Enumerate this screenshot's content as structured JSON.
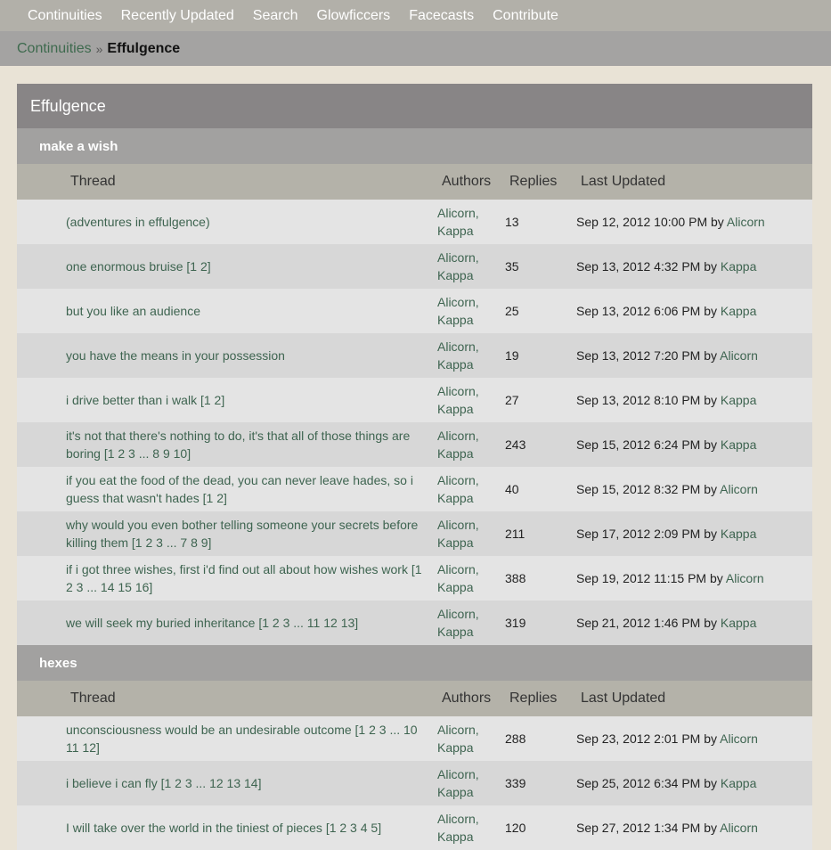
{
  "nav": {
    "items": [
      "Continuities",
      "Recently Updated",
      "Search",
      "Glowficcers",
      "Facecasts",
      "Contribute"
    ]
  },
  "breadcrumb": {
    "parent": "Continuities",
    "separator": "»",
    "current": "Effulgence"
  },
  "continuity": {
    "title": "Effulgence",
    "headers": {
      "thread": "Thread",
      "authors": "Authors",
      "replies": "Replies",
      "updated": "Last Updated"
    },
    "sections": [
      {
        "title": "make a wish",
        "threads": [
          {
            "title": "(adventures in effulgence)",
            "pages": "",
            "author1": "Alicorn,",
            "author2": "Kappa",
            "replies": "13",
            "date": "Sep 12, 2012 10:00 PM",
            "by": "by",
            "last_author": "Alicorn"
          },
          {
            "title": "one enormous bruise",
            "pages": "[1 2]",
            "author1": "Alicorn,",
            "author2": "Kappa",
            "replies": "35",
            "date": "Sep 13, 2012 4:32 PM",
            "by": "by",
            "last_author": "Kappa"
          },
          {
            "title": "but you like an audience",
            "pages": "",
            "author1": "Alicorn,",
            "author2": "Kappa",
            "replies": "25",
            "date": "Sep 13, 2012 6:06 PM",
            "by": "by",
            "last_author": "Kappa"
          },
          {
            "title": "you have the means in your possession",
            "pages": "",
            "author1": "Alicorn,",
            "author2": "Kappa",
            "replies": "19",
            "date": "Sep 13, 2012 7:20 PM",
            "by": "by",
            "last_author": "Alicorn"
          },
          {
            "title": "i drive better than i walk",
            "pages": "[1 2]",
            "author1": "Alicorn,",
            "author2": "Kappa",
            "replies": "27",
            "date": "Sep 13, 2012 8:10 PM",
            "by": "by",
            "last_author": "Kappa"
          },
          {
            "title": "it's not that there's nothing to do, it's that all of those things are boring",
            "pages": "[1 2 3 ... 8 9 10]",
            "author1": "Alicorn,",
            "author2": "Kappa",
            "replies": "243",
            "date": "Sep 15, 2012 6:24 PM",
            "by": "by",
            "last_author": "Kappa"
          },
          {
            "title": "if you eat the food of the dead, you can never leave hades, so i guess that wasn't hades",
            "pages": "[1 2]",
            "author1": "Alicorn,",
            "author2": "Kappa",
            "replies": "40",
            "date": "Sep 15, 2012 8:32 PM",
            "by": "by",
            "last_author": "Alicorn"
          },
          {
            "title": "why would you even bother telling someone your secrets before killing them",
            "pages": "[1 2 3 ... 7 8 9]",
            "author1": "Alicorn,",
            "author2": "Kappa",
            "replies": "211",
            "date": "Sep 17, 2012 2:09 PM",
            "by": "by",
            "last_author": "Kappa"
          },
          {
            "title": "if i got three wishes, first i'd find out all about how wishes work",
            "pages": "[1 2 3 ... 14 15 16]",
            "author1": "Alicorn,",
            "author2": "Kappa",
            "replies": "388",
            "date": "Sep 19, 2012 11:15 PM",
            "by": "by",
            "last_author": "Alicorn"
          },
          {
            "title": "we will seek my buried inheritance",
            "pages": "[1 2 3 ... 11 12 13]",
            "author1": "Alicorn,",
            "author2": "Kappa",
            "replies": "319",
            "date": "Sep 21, 2012 1:46 PM",
            "by": "by",
            "last_author": "Kappa"
          }
        ]
      },
      {
        "title": "hexes",
        "threads": [
          {
            "title": "unconsciousness would be an undesirable outcome",
            "pages": "[1 2 3 ... 10 11 12]",
            "author1": "Alicorn,",
            "author2": "Kappa",
            "replies": "288",
            "date": "Sep 23, 2012 2:01 PM",
            "by": "by",
            "last_author": "Alicorn"
          },
          {
            "title": "i believe i can fly",
            "pages": "[1 2 3 ... 12 13 14]",
            "author1": "Alicorn,",
            "author2": "Kappa",
            "replies": "339",
            "date": "Sep 25, 2012 6:34 PM",
            "by": "by",
            "last_author": "Kappa"
          },
          {
            "title": "I will take over the world in the tiniest of pieces",
            "pages": "[1 2 3 4 5]",
            "author1": "Alicorn,",
            "author2": "Kappa",
            "replies": "120",
            "date": "Sep 27, 2012 1:34 PM",
            "by": "by",
            "last_author": "Alicorn"
          }
        ]
      }
    ]
  }
}
